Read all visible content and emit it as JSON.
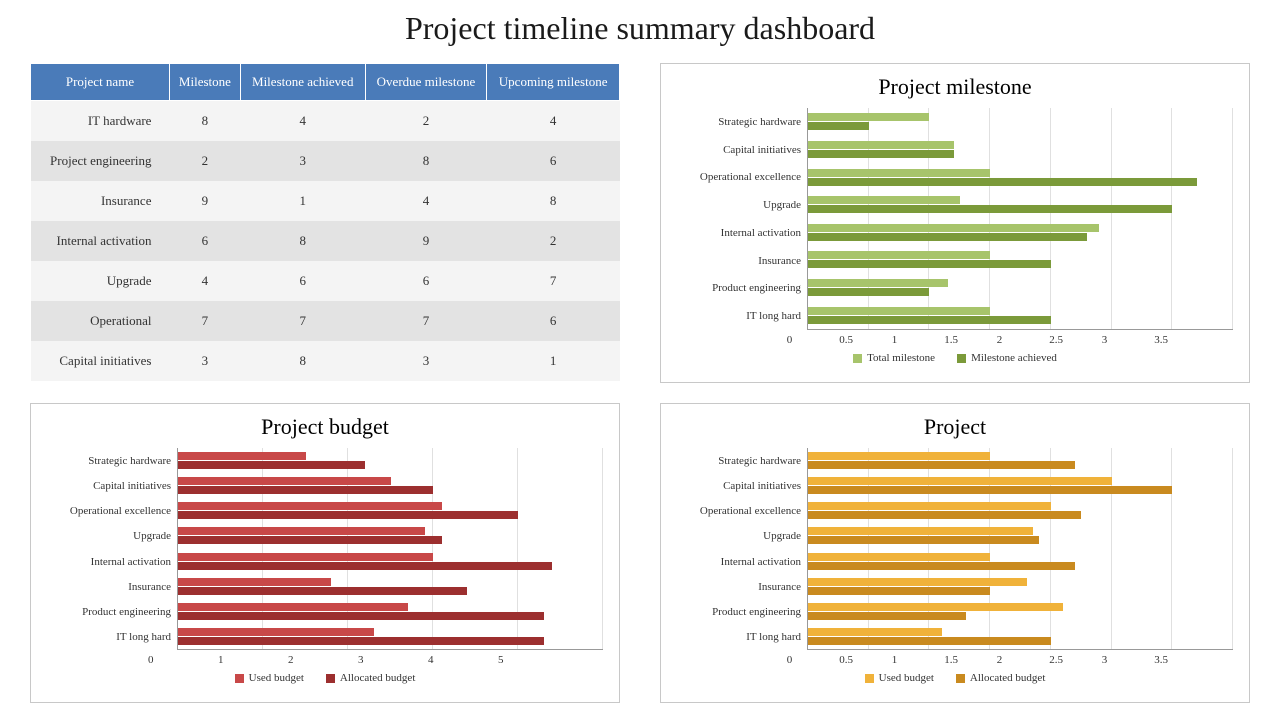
{
  "title": "Project timeline summary dashboard",
  "table": {
    "headers": [
      "Project name",
      "Milestone",
      "Milestone achieved",
      "Overdue milestone",
      "Upcoming milestone"
    ],
    "rows": [
      [
        "IT hardware",
        8,
        4,
        2,
        4
      ],
      [
        "Project engineering",
        2,
        3,
        8,
        6
      ],
      [
        "Insurance",
        9,
        1,
        4,
        8
      ],
      [
        "Internal activation",
        6,
        8,
        9,
        2
      ],
      [
        "Upgrade",
        4,
        6,
        6,
        7
      ],
      [
        "Operational",
        7,
        7,
        7,
        6
      ],
      [
        "Capital initiatives",
        3,
        8,
        3,
        1
      ]
    ]
  },
  "chart_data": [
    {
      "id": "milestone",
      "type": "bar",
      "orientation": "horizontal",
      "title": "Project milestone",
      "categories": [
        "Strategic hardware",
        "Capital initiatives",
        "Operational excellence",
        "Upgrade",
        "Internal activation",
        "Insurance",
        "Product engineering",
        "IT long hard"
      ],
      "series": [
        {
          "name": "Total milestone",
          "color": "#a7c46b",
          "values": [
            1.0,
            1.2,
            1.5,
            1.25,
            2.4,
            1.5,
            1.15,
            1.5
          ]
        },
        {
          "name": "Milestone achieved",
          "color": "#7b9a3a",
          "values": [
            0.5,
            1.2,
            3.2,
            3.0,
            2.3,
            2.0,
            1.0,
            2.0
          ]
        }
      ],
      "xlim": [
        0,
        3.5
      ],
      "xticks": [
        0,
        0.5,
        1,
        1.5,
        2,
        2.5,
        3,
        3.5
      ]
    },
    {
      "id": "budget",
      "type": "bar",
      "orientation": "horizontal",
      "title": "Project budget",
      "categories": [
        "Strategic hardware",
        "Capital initiatives",
        "Operational excellence",
        "Upgrade",
        "Internal activation",
        "Insurance",
        "Product engineering",
        "IT long hard"
      ],
      "series": [
        {
          "name": "Used budget",
          "color": "#c84848",
          "values": [
            1.5,
            2.5,
            3.1,
            2.9,
            3.0,
            1.8,
            2.7,
            2.3
          ]
        },
        {
          "name": "Allocated budget",
          "color": "#9c2f2f",
          "values": [
            2.2,
            3.0,
            4.0,
            3.1,
            4.4,
            3.4,
            4.3,
            4.3
          ]
        }
      ],
      "xlim": [
        0,
        5
      ],
      "xticks": [
        0,
        1,
        2,
        3,
        4,
        5
      ]
    },
    {
      "id": "project",
      "type": "bar",
      "orientation": "horizontal",
      "title": "Project",
      "categories": [
        "Strategic hardware",
        "Capital initiatives",
        "Operational excellence",
        "Upgrade",
        "Internal activation",
        "Insurance",
        "Product engineering",
        "IT long hard"
      ],
      "series": [
        {
          "name": "Used budget",
          "color": "#f0b23a",
          "values": [
            1.5,
            2.5,
            2.0,
            1.85,
            1.5,
            1.8,
            2.1,
            1.1
          ]
        },
        {
          "name": "Allocated budget",
          "color": "#c98a1f",
          "values": [
            2.2,
            3.0,
            2.25,
            1.9,
            2.2,
            1.5,
            1.3,
            2.0
          ]
        }
      ],
      "xlim": [
        0,
        3.5
      ],
      "xticks": [
        0,
        0.5,
        1,
        1.5,
        2,
        2.5,
        3,
        3.5
      ]
    }
  ]
}
